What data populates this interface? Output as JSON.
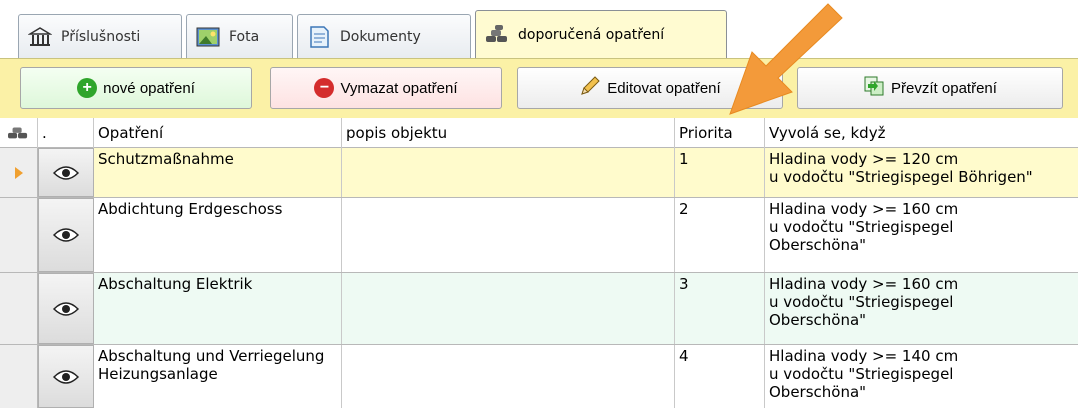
{
  "tabs": [
    {
      "label": "Příslušnosti",
      "icon": "building-icon"
    },
    {
      "label": "Fota",
      "icon": "photo-icon"
    },
    {
      "label": "Dokumenty",
      "icon": "document-icon"
    },
    {
      "label": "doporučená opatření",
      "icon": "sandbag-icon",
      "active": true
    }
  ],
  "toolbar": {
    "new_label": "nové opatření",
    "delete_label": "Vymazat opatření",
    "edit_label": "Editovat opatření",
    "take_label": "Převzít opatření"
  },
  "table": {
    "columns": [
      ".",
      "Opatření",
      "popis objektu",
      "Priorita",
      "Vyvolá se, když"
    ],
    "rows": [
      {
        "measure": "Schutzmaßnahme",
        "description": "",
        "priority": "1",
        "trigger": [
          "Hladina vody >= 120 cm",
          "u vodočtu \"Striegispegel Böhrigen\""
        ]
      },
      {
        "measure": "Abdichtung Erdgeschoss",
        "description": "",
        "priority": "2",
        "trigger": [
          "Hladina vody >= 160 cm",
          "u vodočtu \"Striegispegel",
          "Oberschöna\""
        ]
      },
      {
        "measure": "Abschaltung Elektrik",
        "description": "",
        "priority": "3",
        "trigger": [
          "Hladina vody >= 160 cm",
          "u vodočtu \"Striegispegel",
          "Oberschöna\""
        ]
      },
      {
        "measure": "Abschaltung und Verriegelung Heizungsanlage",
        "description": "",
        "priority": "4",
        "trigger": [
          "Hladina vody >= 140 cm",
          "u vodočtu \"Striegispegel",
          "Oberschöna\""
        ]
      }
    ]
  },
  "colors": {
    "toolbar_bg": "#fbf1a6",
    "selected_row": "#fffbcc",
    "alt_row": "#eefaf3",
    "arrow": "#f39a3a"
  }
}
